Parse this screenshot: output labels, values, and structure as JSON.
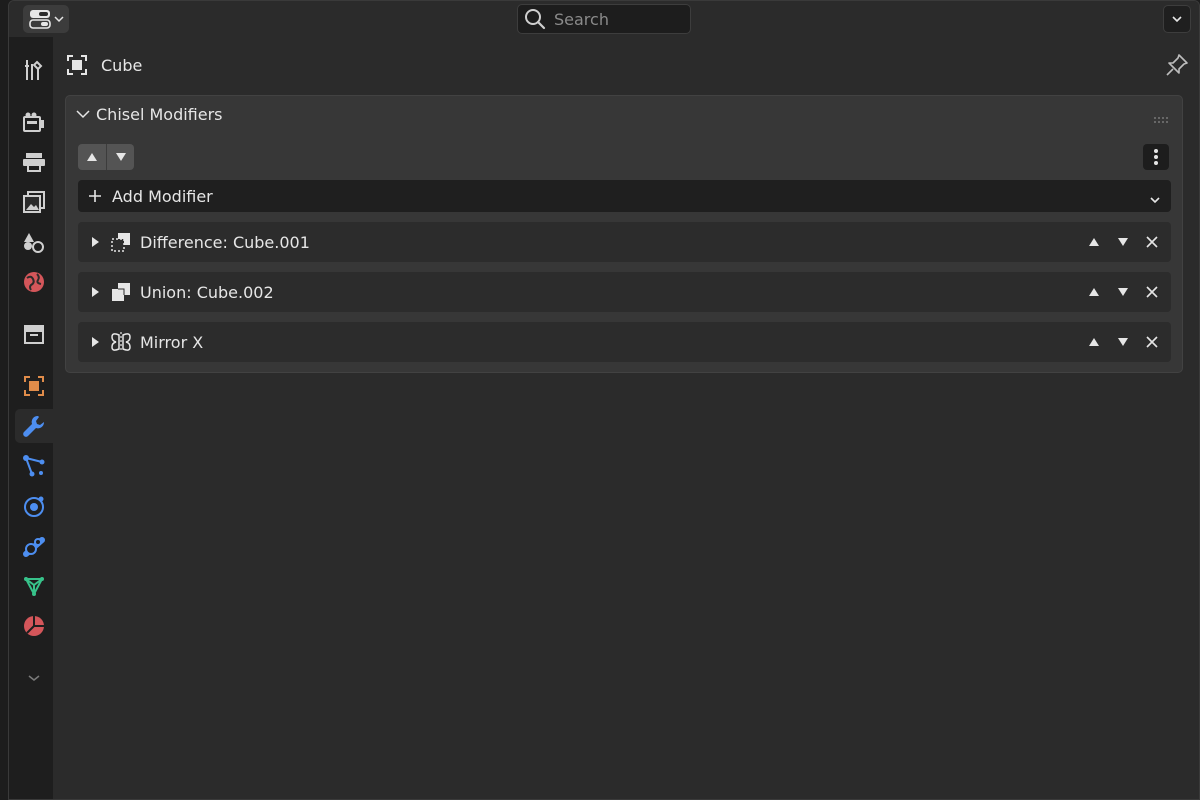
{
  "header": {
    "search_placeholder": "Search"
  },
  "context": {
    "object_name": "Cube"
  },
  "panel": {
    "title": "Chisel Modifiers",
    "add_modifier_label": "Add Modifier",
    "modifiers": [
      {
        "name": "Difference: Cube.001",
        "icon": "difference-icon"
      },
      {
        "name": "Union: Cube.002",
        "icon": "union-icon"
      },
      {
        "name": "Mirror X",
        "icon": "mirror-icon"
      }
    ]
  },
  "tabs": [
    {
      "name": "tool-tab",
      "icon": "tool-icon"
    },
    {
      "name": "render-tab",
      "icon": "render-icon"
    },
    {
      "name": "output-tab",
      "icon": "output-icon"
    },
    {
      "name": "view-layer-tab",
      "icon": "view-layer-icon"
    },
    {
      "name": "scene-tab",
      "icon": "scene-icon"
    },
    {
      "name": "world-tab",
      "icon": "world-icon"
    },
    {
      "name": "collection-tab",
      "icon": "collection-icon"
    },
    {
      "name": "object-tab",
      "icon": "object-icon"
    },
    {
      "name": "modifiers-tab",
      "icon": "wrench-icon",
      "active": true
    },
    {
      "name": "particles-tab",
      "icon": "particles-icon"
    },
    {
      "name": "physics-tab",
      "icon": "physics-icon"
    },
    {
      "name": "constraints-tab",
      "icon": "constraints-icon"
    },
    {
      "name": "data-tab",
      "icon": "mesh-data-icon"
    },
    {
      "name": "material-tab",
      "icon": "material-icon"
    }
  ],
  "colors": {
    "accent_blue": "#4d8ef0",
    "object_orange": "#e08c4a",
    "data_green": "#37c28a",
    "material_red": "#d4565a"
  }
}
